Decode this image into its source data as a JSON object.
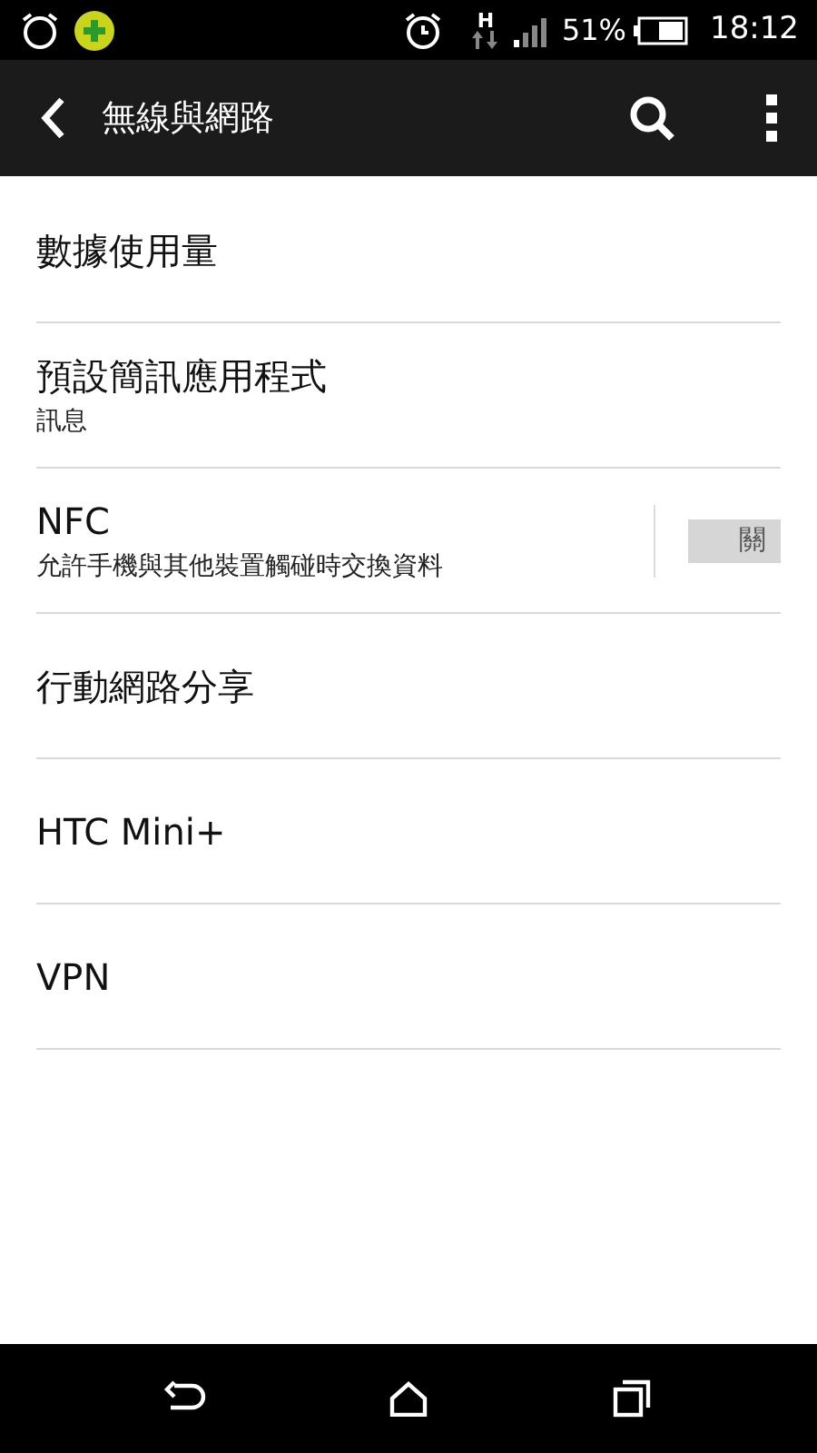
{
  "status_bar": {
    "network_type": "H",
    "battery": "51%",
    "time": "18:12"
  },
  "app_bar": {
    "title": "無線與網路"
  },
  "items": [
    {
      "kind": "plain",
      "title": "數據使用量"
    },
    {
      "kind": "plain",
      "title": "預設簡訊應用程式",
      "subtitle": "訊息"
    },
    {
      "kind": "toggle",
      "title": "NFC",
      "subtitle": "允許手機與其他裝置觸碰時交換資料",
      "on": false,
      "toggle_label": "關"
    },
    {
      "kind": "plain",
      "title": "行動網路分享"
    },
    {
      "kind": "plain",
      "title": "HTC Mini+"
    },
    {
      "kind": "plain",
      "title": "VPN"
    }
  ]
}
